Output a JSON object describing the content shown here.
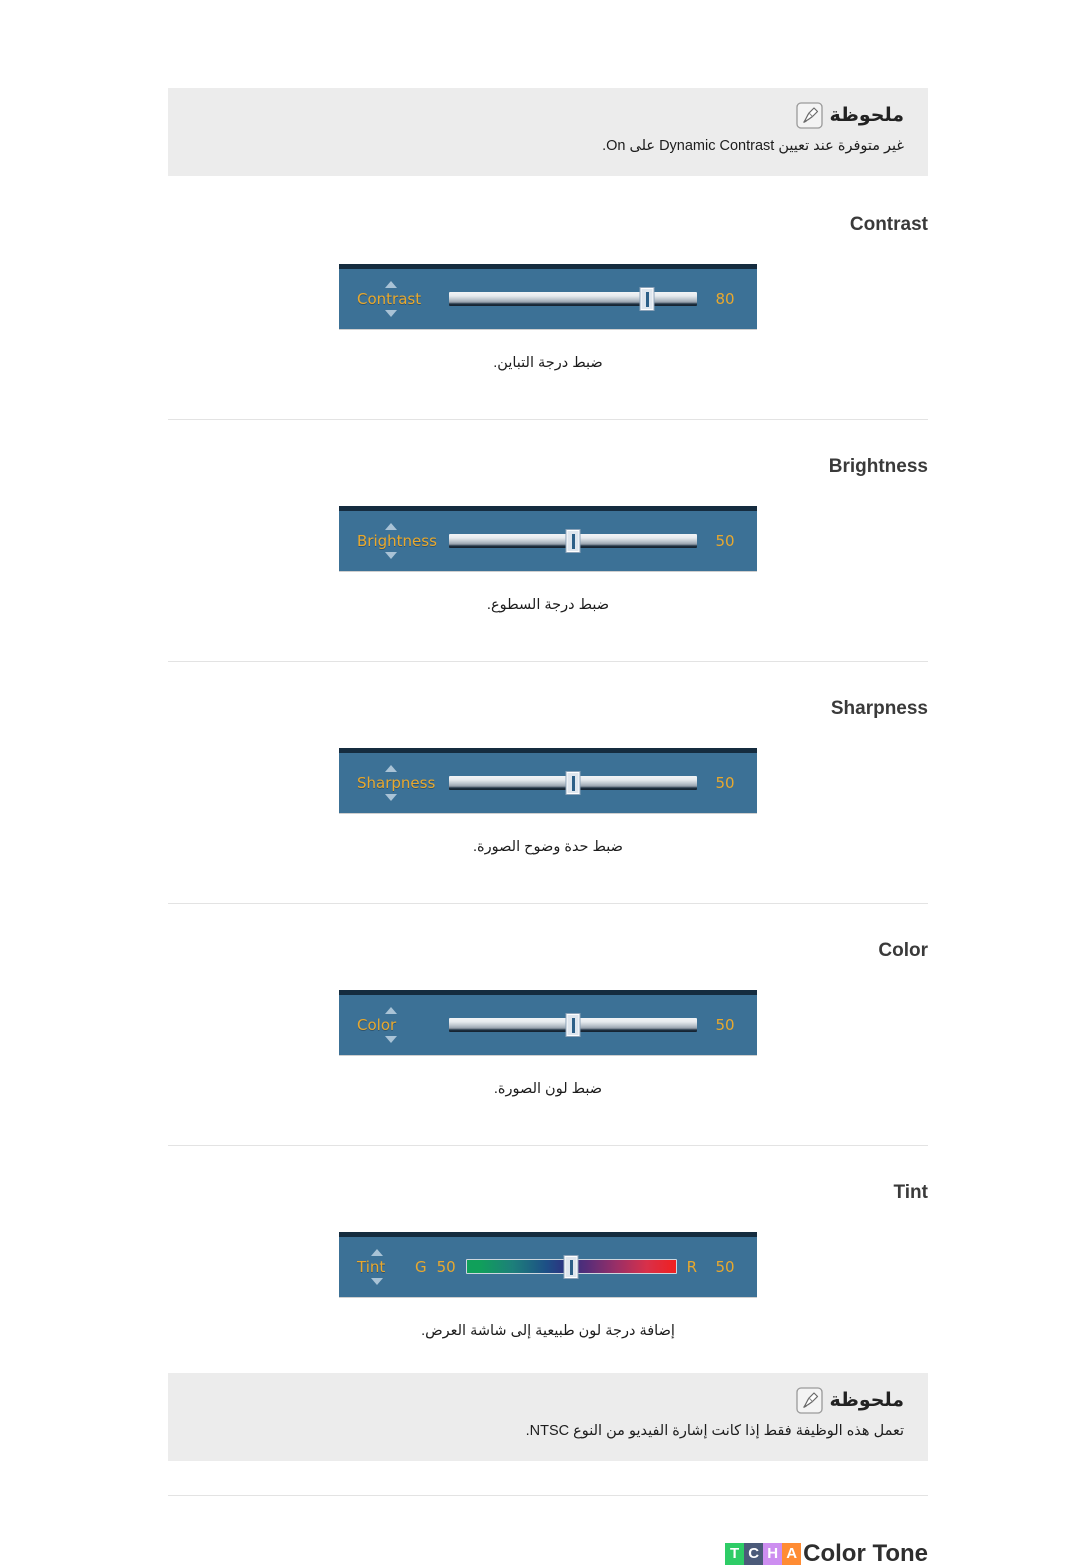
{
  "page": {
    "language": "ar",
    "direction": "rtl"
  },
  "note_top": {
    "title": "ملحوظة",
    "icon": "note-pen-icon",
    "text_before": "غير متوفرة عند تعيين",
    "text_en": "Dynamic Contrast",
    "text_middle": "على",
    "text_en2": "On",
    "text_after": ".",
    "full_text": "غير متوفرة عند تعيين Dynamic Contrast على On."
  },
  "sections": [
    {
      "id": "contrast",
      "title": "Contrast",
      "description": "ضبط درجة التباين.",
      "osd": {
        "label": "Contrast",
        "value": "80",
        "fill_percent": 80,
        "type": "plain",
        "left_label": "",
        "right_label": ""
      }
    },
    {
      "id": "brightness",
      "title": "Brightness",
      "description": "ضبط درجة السطوع.",
      "osd": {
        "label": "Brightness",
        "value": "50",
        "fill_percent": 50,
        "type": "plain",
        "left_label": "",
        "right_label": ""
      }
    },
    {
      "id": "sharpness",
      "title": "Sharpness",
      "description": "ضبط حدة وضوح الصورة.",
      "osd": {
        "label": "Sharpness",
        "value": "50",
        "fill_percent": 50,
        "type": "plain",
        "left_label": "",
        "right_label": ""
      }
    },
    {
      "id": "color",
      "title": "Color",
      "description": "ضبط لون الصورة.",
      "osd": {
        "label": "Color",
        "value": "50",
        "fill_percent": 50,
        "type": "plain",
        "left_label": "",
        "right_label": ""
      }
    },
    {
      "id": "tint",
      "title": "Tint",
      "description": "إضافة درجة لون طبيعية إلى شاشة العرض.",
      "osd": {
        "label": "Tint",
        "value": "50",
        "fill_percent": 50,
        "type": "gradient",
        "left_label": "G",
        "left_value": "50",
        "right_label": "R",
        "right_value": "50"
      }
    }
  ],
  "note_bottom": {
    "title": "ملحوظة",
    "icon": "note-pen-icon",
    "full_text": "تعمل هذه الوظيفة فقط إذا كانت إشارة الفيديو من النوع NTSC."
  },
  "color_tone": {
    "tags": [
      {
        "letter": "T",
        "color": "#2ecc66"
      },
      {
        "letter": "C",
        "color": "#4b5a79"
      },
      {
        "letter": "H",
        "color": "#cd8ef0"
      },
      {
        "letter": "A",
        "color": "#ff8c33"
      }
    ],
    "title": "Color Tone"
  },
  "colors": {
    "osd_background": "#3c7196",
    "osd_top_bar": "#152c3f",
    "osd_text": "#e8a82e",
    "osd_arrow": "#a9c3d6",
    "note_background": "#ececec",
    "divider": "#e3e3e3",
    "heading": "#3a3a3a"
  }
}
